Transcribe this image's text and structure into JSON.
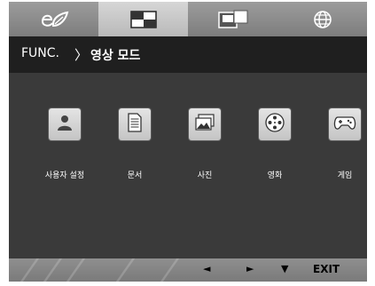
{
  "tabs": [
    {
      "icon": "eco-icon",
      "active": false
    },
    {
      "icon": "picture-mode-icon",
      "active": true
    },
    {
      "icon": "split-screen-icon",
      "active": false
    },
    {
      "icon": "globe-icon",
      "active": false
    }
  ],
  "header": {
    "func_label": "FUNC.",
    "separator": "〉",
    "mode_title": "영상 모드"
  },
  "modes": [
    {
      "label": "사용자 설정",
      "icon": "person-icon"
    },
    {
      "label": "문서",
      "icon": "document-icon"
    },
    {
      "label": "사진",
      "icon": "photo-icon"
    },
    {
      "label": "영화",
      "icon": "film-reel-icon"
    },
    {
      "label": "게임",
      "icon": "gamepad-icon"
    }
  ],
  "footer": {
    "left_arrow": "◄",
    "right_arrow": "►",
    "down_arrow": "▼",
    "exit_label": "EXIT"
  },
  "colors": {
    "panel": "#3a3a3a",
    "titlebar": "#1f1f1f",
    "tab_bar": "#8a8a8a",
    "active_tab": "#c8c8c8"
  }
}
